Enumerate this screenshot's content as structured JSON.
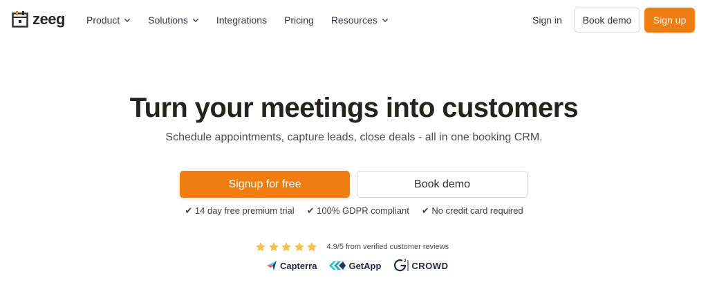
{
  "nav": {
    "logo_text": "zeeg",
    "menu": [
      {
        "label": "Product",
        "dropdown": true
      },
      {
        "label": "Solutions",
        "dropdown": true
      },
      {
        "label": "Integrations",
        "dropdown": false
      },
      {
        "label": "Pricing",
        "dropdown": false
      },
      {
        "label": "Resources",
        "dropdown": true
      }
    ],
    "sign_in": "Sign in",
    "book_demo": "Book demo",
    "sign_up": "Sign up"
  },
  "hero": {
    "title": "Turn your meetings into customers",
    "subtitle": "Schedule appointments, capture leads, close deals - all in one booking CRM.",
    "cta_primary": "Signup for free",
    "cta_secondary": "Book demo",
    "features": [
      "✔ 14 day free premium trial",
      "✔ 100% GDPR compliant",
      "✔ No credit card required"
    ]
  },
  "rating": {
    "stars": 5,
    "text": "4.9/5 from verified customer reviews"
  },
  "review_sites": [
    {
      "name": "Capterra",
      "icon": "capterra-icon"
    },
    {
      "name": "GetApp",
      "icon": "getapp-icon"
    },
    {
      "name": "CROWD",
      "icon": "g2-icon"
    }
  ],
  "colors": {
    "accent": "#ef7d12",
    "heading": "#24231c",
    "star": "#f5c04a"
  }
}
